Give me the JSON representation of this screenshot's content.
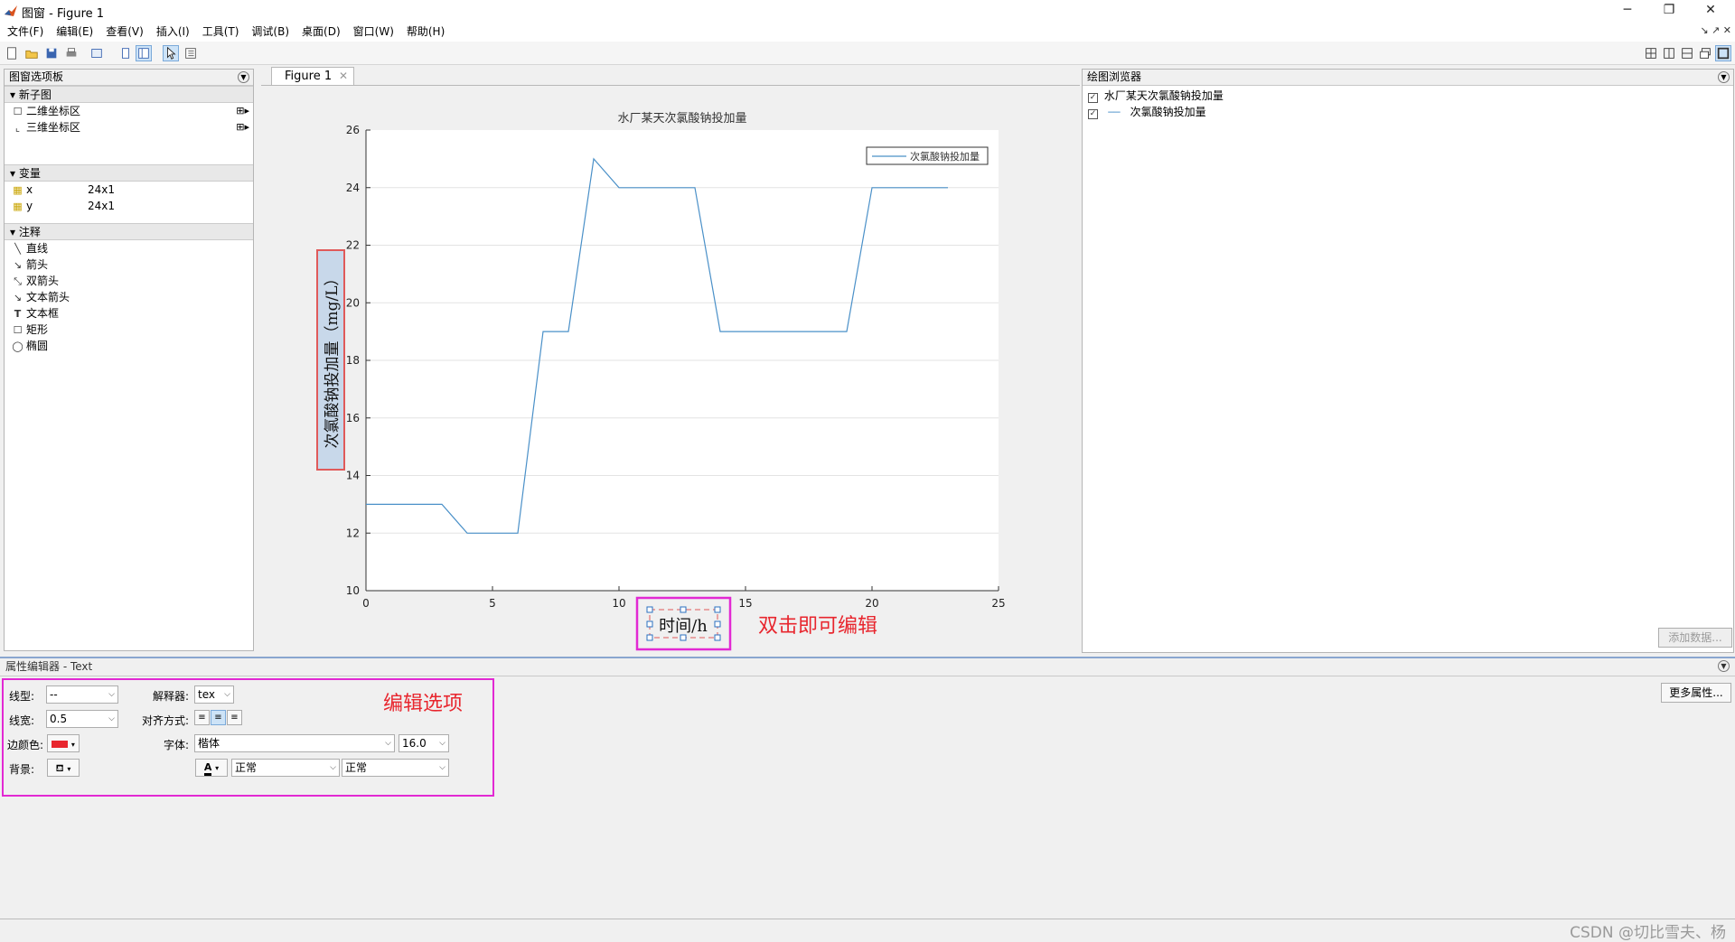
{
  "window": {
    "title": "图窗 - Figure 1",
    "min_label": "─",
    "restore_label": "❐",
    "close_label": "✕"
  },
  "menu": [
    "文件(F)",
    "编辑(E)",
    "查看(V)",
    "插入(I)",
    "工具(T)",
    "调试(B)",
    "桌面(D)",
    "窗口(W)",
    "帮助(H)"
  ],
  "menu_right_glyphs": "↘ ↗ ✕",
  "palette": {
    "title": "图窗选项板",
    "sections": {
      "new_subplot": {
        "label": "新子图",
        "items": [
          "二维坐标区",
          "三维坐标区"
        ]
      },
      "variables": {
        "label": "变量",
        "items": [
          {
            "name": "x",
            "size": "24x1"
          },
          {
            "name": "y",
            "size": "24x1"
          }
        ]
      },
      "annotations": {
        "label": "注释",
        "items": [
          "直线",
          "箭头",
          "双箭头",
          "文本箭头",
          "文本框",
          "矩形",
          "椭圆"
        ]
      }
    }
  },
  "figure_tab": {
    "label": "Figure 1",
    "close": "✕"
  },
  "plot_browser": {
    "title": "绘图浏览器",
    "items": [
      "水厂某天次氯酸钠投加量",
      "次氯酸钠投加量"
    ],
    "add_data_label": "添加数据..."
  },
  "annotations": {
    "double_click_hint": "双击即可编辑",
    "edit_options_hint": "编辑选项"
  },
  "property_editor": {
    "title": "属性编辑器 - Text",
    "line_style_label": "线型:",
    "line_style_value": "--",
    "line_width_label": "线宽:",
    "line_width_value": "0.5",
    "edge_color_label": "边颜色:",
    "background_label": "背景:",
    "interpreter_label": "解释器:",
    "interpreter_value": "tex",
    "alignment_label": "对齐方式:",
    "font_label": "字体:",
    "font_value": "楷体",
    "font_size_value": "16.0",
    "font_weight_value": "正常",
    "font_angle_value": "正常",
    "more_props_label": "更多属性..."
  },
  "watermark": "CSDN @切比雪夫、杨",
  "colors": {
    "line": "#4a90c8",
    "annotation_red": "#e8262e",
    "highlight_magenta": "#e229d3",
    "ylabel_bg": "#c8d8ea",
    "ylabel_border": "#e05a5a"
  },
  "chart_data": {
    "type": "line",
    "title": "水厂某天次氯酸钠投加量",
    "xlabel": "时间/h",
    "ylabel": "次氯酸钠投加量（mg/L）",
    "xlim": [
      0,
      25
    ],
    "ylim": [
      10,
      26
    ],
    "xticks": [
      0,
      5,
      10,
      15,
      20,
      25
    ],
    "yticks": [
      10,
      12,
      14,
      16,
      18,
      20,
      22,
      24,
      26
    ],
    "grid": "y-major",
    "legend": "top-right",
    "series": [
      {
        "name": "次氯酸钠投加量",
        "x": [
          0,
          1,
          2,
          3,
          4,
          5,
          6,
          7,
          8,
          9,
          10,
          11,
          12,
          13,
          14,
          15,
          16,
          17,
          18,
          19,
          20,
          21,
          22,
          23
        ],
        "y": [
          13,
          13,
          13,
          13,
          12,
          12,
          12,
          19,
          19,
          25,
          24,
          24,
          24,
          24,
          19,
          19,
          19,
          19,
          19,
          19,
          24,
          24,
          24,
          24
        ]
      }
    ]
  }
}
